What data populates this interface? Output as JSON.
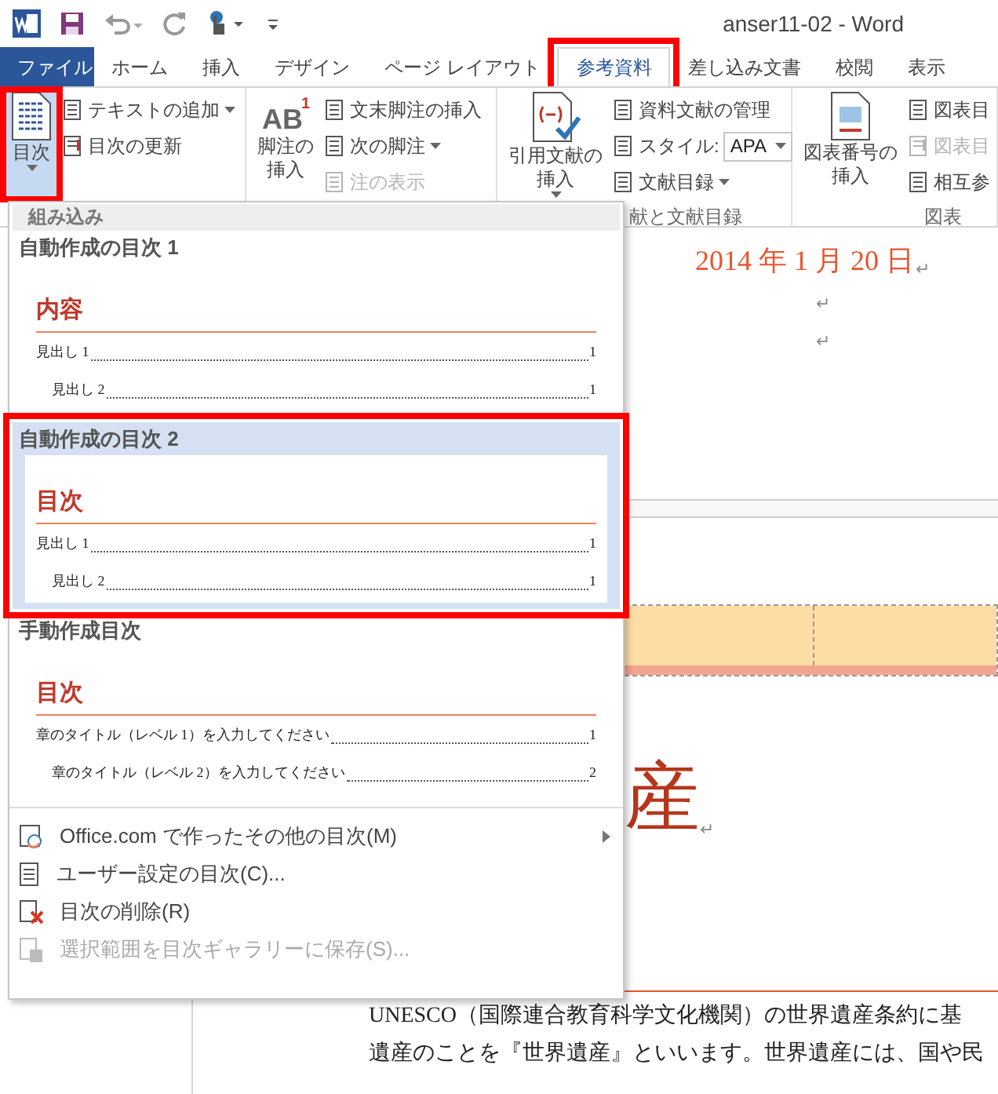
{
  "title_bar": {
    "title": "anser11-02 - Word"
  },
  "tabs": [
    {
      "label": "ファイル",
      "kind": "file",
      "selected": false,
      "annotated": false
    },
    {
      "label": "ホーム",
      "kind": "tab",
      "selected": false,
      "annotated": false
    },
    {
      "label": "挿入",
      "kind": "tab",
      "selected": false,
      "annotated": false
    },
    {
      "label": "デザイン",
      "kind": "tab",
      "selected": false,
      "annotated": false
    },
    {
      "label": "ページ レイアウト",
      "kind": "tab",
      "selected": false,
      "annotated": false
    },
    {
      "label": "参考資料",
      "kind": "tab",
      "selected": true,
      "annotated": true
    },
    {
      "label": "差し込み文書",
      "kind": "tab",
      "selected": false,
      "annotated": false
    },
    {
      "label": "校閲",
      "kind": "tab",
      "selected": false,
      "annotated": false
    },
    {
      "label": "表示",
      "kind": "tab",
      "selected": false,
      "annotated": false
    }
  ],
  "ribbon_groups": [
    {
      "large": {
        "label_lines": [
          "目次"
        ],
        "caret": true,
        "pressed": true,
        "annotated": true
      },
      "small": [
        {
          "kind": "button",
          "label": "テキストの追加",
          "caret": true,
          "disabled": false
        },
        {
          "kind": "button",
          "label": "目次の更新",
          "caret": false,
          "disabled": false
        }
      ]
    },
    {
      "large": {
        "label_lines": [
          "脚注の",
          "挿入"
        ],
        "icon_text": "AB",
        "icon_superscript": "1",
        "caret": false,
        "pressed": false,
        "annotated": false
      },
      "small": [
        {
          "kind": "button",
          "label": "文末脚注の挿入",
          "caret": false,
          "disabled": false
        },
        {
          "kind": "button",
          "label": "次の脚注",
          "caret": true,
          "disabled": false
        },
        {
          "kind": "button",
          "label": "注の表示",
          "caret": false,
          "disabled": true
        }
      ]
    },
    {
      "label": "献と文献目録",
      "large": {
        "label_lines": [
          "引用文献の",
          "挿入"
        ],
        "caret": true,
        "pressed": false,
        "annotated": false
      },
      "small": [
        {
          "kind": "button",
          "label": "資料文献の管理",
          "caret": false,
          "disabled": false
        },
        {
          "kind": "select",
          "label": "スタイル:",
          "value": "APA",
          "disabled": false
        },
        {
          "kind": "button",
          "label": "文献目録",
          "caret": true,
          "disabled": false
        }
      ]
    },
    {
      "label": "図表",
      "large": {
        "label_lines": [
          "図表番号の",
          "挿入"
        ],
        "caret": false,
        "pressed": false,
        "annotated": false
      },
      "small": [
        {
          "kind": "button",
          "label": "図表目",
          "caret": false,
          "disabled": false
        },
        {
          "kind": "button",
          "label": "図表目",
          "caret": false,
          "disabled": true
        },
        {
          "kind": "button",
          "label": "相互参",
          "caret": false,
          "disabled": false
        }
      ]
    }
  ],
  "toc_menu": {
    "section": "組み込み",
    "gallery": [
      {
        "title": "自動作成の目次 1",
        "selected": false,
        "annotated": false,
        "heading": "内容",
        "entries": [
          {
            "text": "見出し 1",
            "page": "1",
            "children": [
              {
                "text": "見出し 2",
                "page": "1"
              }
            ]
          }
        ]
      },
      {
        "title": "自動作成の目次 2",
        "selected": true,
        "annotated": true,
        "heading": "目次",
        "entries": [
          {
            "text": "見出し 1",
            "page": "1",
            "children": [
              {
                "text": "見出し 2",
                "page": "1"
              }
            ]
          }
        ]
      },
      {
        "title": "手動作成目次",
        "selected": false,
        "annotated": false,
        "heading": "目次",
        "entries": [
          {
            "text": "章のタイトル（レベル 1）を入力してください",
            "page": "1",
            "children": [
              {
                "text": "章のタイトル（レベル 2）を入力してください",
                "page": "2"
              }
            ]
          }
        ]
      }
    ],
    "items": [
      {
        "label": "Office.com で作ったその他の目次(M)",
        "submenu": true,
        "disabled": false
      },
      {
        "label": "ユーザー設定の目次(C)...",
        "submenu": false,
        "disabled": false
      },
      {
        "label": "目次の削除(R)",
        "submenu": false,
        "disabled": false
      },
      {
        "label": "選択範囲を目次ギャラリーに保存(S)...",
        "submenu": false,
        "disabled": true
      }
    ]
  },
  "document": {
    "date": {
      "text": "2014 年 1 月 20 日",
      "mark": "↵"
    },
    "empty_marks": [
      "↵",
      "↵"
    ],
    "title": {
      "text": "産",
      "mark": "↵"
    },
    "body": [
      "UNESCO（国際連合教育科学文化機関）の世界遺産条約に基",
      "遺産のことを『世界遺産』といいます。世界遺産には、国や民"
    ]
  }
}
